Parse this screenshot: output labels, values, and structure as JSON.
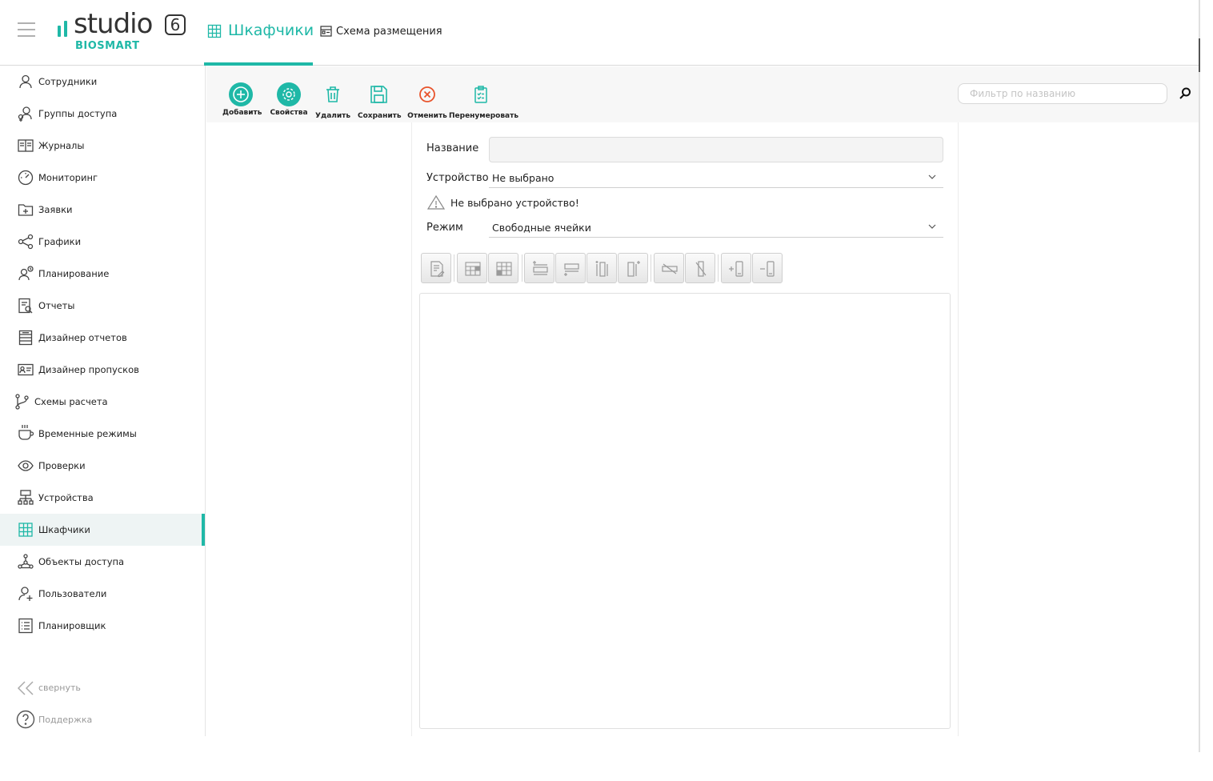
{
  "app": {
    "logo_text": "studio",
    "logo_version": "6",
    "logo_brand": "BIOSMART"
  },
  "header": {
    "active_tab": "Шкафчики",
    "second_tab": "Схема размещения"
  },
  "sidebar": {
    "items": [
      {
        "label": "Сотрудники",
        "icon": "person-icon"
      },
      {
        "label": "Группы доступа",
        "icon": "group-icon"
      },
      {
        "label": "Журналы",
        "icon": "book-icon"
      },
      {
        "label": "Мониторинг",
        "icon": "gauge-icon"
      },
      {
        "label": "Заявки",
        "icon": "folder-plus-icon"
      },
      {
        "label": "Графики",
        "icon": "share-icon"
      },
      {
        "label": "Планирование",
        "icon": "person-clock-icon"
      },
      {
        "label": "Отчеты",
        "icon": "report-search-icon"
      },
      {
        "label": "Дизайнер отчетов",
        "icon": "report-designer-icon"
      },
      {
        "label": "Дизайнер пропусков",
        "icon": "id-card-icon"
      },
      {
        "label": "Схемы расчета",
        "icon": "branch-icon"
      },
      {
        "label": "Временные режимы",
        "icon": "cup-icon"
      },
      {
        "label": "Проверки",
        "icon": "eye-icon"
      },
      {
        "label": "Устройства",
        "icon": "network-icon"
      },
      {
        "label": "Шкафчики",
        "icon": "lockers-icon"
      },
      {
        "label": "Объекты доступа",
        "icon": "objects-icon"
      },
      {
        "label": "Пользователи",
        "icon": "user-plus-icon"
      },
      {
        "label": "Планировщик",
        "icon": "list-icon"
      }
    ],
    "collapse_label": "свернуть",
    "support_label": "Поддержка"
  },
  "toolbar": {
    "add": "Добавить",
    "properties": "Свойства",
    "delete": "Удалить",
    "save": "Сохранить",
    "cancel": "Отменить",
    "renumber": "Перенумеровать",
    "filter_placeholder": "Фильтр по названию"
  },
  "form": {
    "name_label": "Название",
    "name_value": "",
    "device_label": "Устройство",
    "device_value": "Не выбрано",
    "warning_text": "Не выбрано устройство!",
    "mode_label": "Режим",
    "mode_value": "Свободные ячейки"
  },
  "colors": {
    "accent": "#1fb8a7",
    "cancel": "#e8532b"
  }
}
